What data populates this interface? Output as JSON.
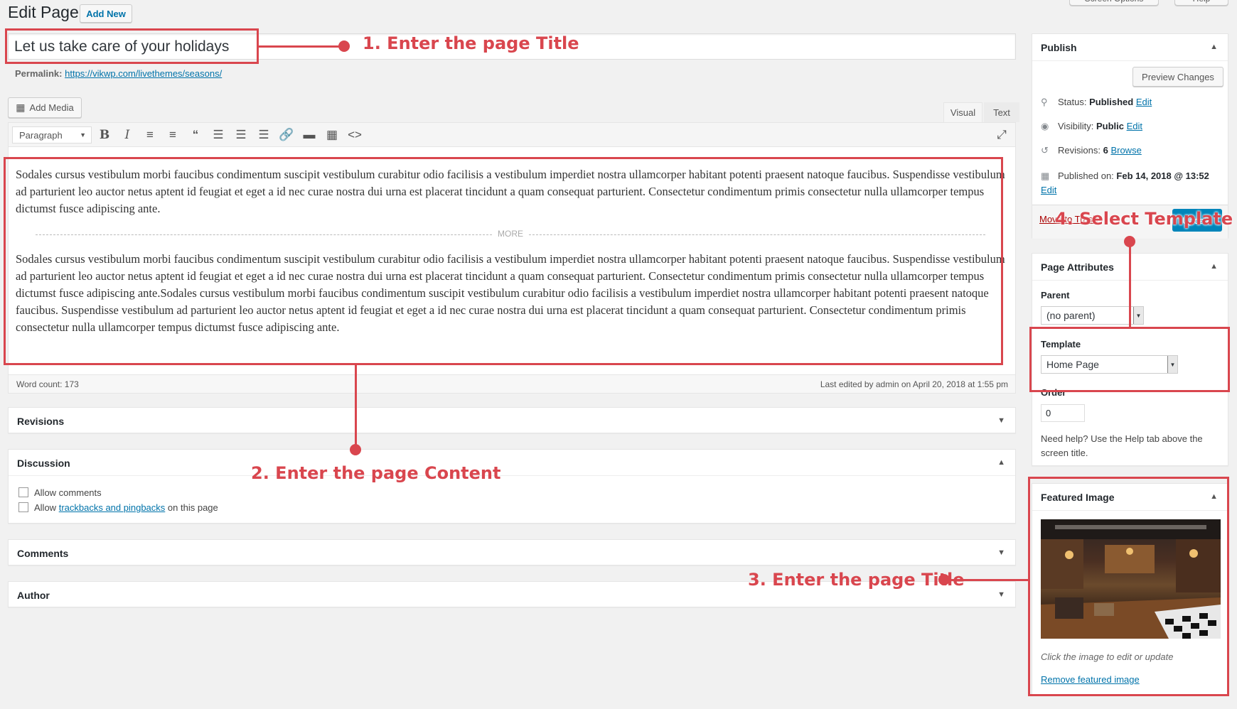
{
  "header": {
    "title": "Edit Page",
    "add_new": "Add New",
    "screen_options": "Screen Options",
    "help": "Help"
  },
  "editor": {
    "title_value": "Let us take care of your holidays",
    "permalink_label": "Permalink:",
    "permalink_url": "https://vikwp.com/livethemes/seasons/",
    "add_media": "Add Media",
    "tab_visual": "Visual",
    "tab_text": "Text",
    "format_select": "Paragraph",
    "paragraph1": "Sodales cursus vestibulum morbi faucibus condimentum suscipit vestibulum curabitur odio facilisis a vestibulum imperdiet nostra ullamcorper habitant potenti praesent natoque faucibus. Suspendisse vestibulum ad parturient leo auctor netus aptent id feugiat et eget a id nec curae nostra dui urna est placerat tincidunt a quam consequat parturient. Consectetur condimentum primis consectetur nulla ullamcorper tempus dictumst fusce adipiscing ante.",
    "more_label": "MORE",
    "paragraph2": "Sodales cursus vestibulum morbi faucibus condimentum suscipit vestibulum curabitur odio facilisis a vestibulum imperdiet nostra ullamcorper habitant potenti praesent natoque faucibus. Suspendisse vestibulum ad parturient leo auctor netus aptent id feugiat et eget a id nec curae nostra dui urna est placerat tincidunt a quam consequat parturient. Consectetur condimentum primis consectetur nulla ullamcorper tempus dictumst fusce adipiscing ante.Sodales cursus vestibulum morbi faucibus condimentum suscipit vestibulum curabitur odio facilisis a vestibulum imperdiet nostra ullamcorper habitant potenti praesent natoque faucibus. Suspendisse vestibulum ad parturient leo auctor netus aptent id feugiat et eget a id nec curae nostra dui urna est placerat tincidunt a quam consequat parturient. Consectetur condimentum primis consectetur nulla ullamcorper tempus dictumst fusce adipiscing ante.",
    "word_count": "Word count: 173",
    "last_edited": "Last edited by admin on April 20, 2018 at 1:55 pm"
  },
  "boxes": {
    "revisions": "Revisions",
    "discussion": "Discussion",
    "allow_comments": "Allow comments",
    "allow_prefix": "Allow",
    "trackbacks_link": "trackbacks and pingbacks",
    "allow_suffix": "on this page",
    "comments": "Comments",
    "author": "Author"
  },
  "publish": {
    "title": "Publish",
    "preview": "Preview Changes",
    "status_label": "Status:",
    "status_value": "Published",
    "visibility_label": "Visibility:",
    "visibility_value": "Public",
    "revisions_label": "Revisions:",
    "revisions_value": "6",
    "browse": "Browse",
    "published_label": "Published on:",
    "published_value": "Feb 14, 2018 @ 13:52",
    "edit": "Edit",
    "move_trash": "Move to Trash",
    "update": "Update"
  },
  "attributes": {
    "title": "Page Attributes",
    "parent_label": "Parent",
    "parent_value": "(no parent)",
    "template_label": "Template",
    "template_value": "Home Page",
    "order_label": "Order",
    "order_value": "0",
    "help_text": "Need help? Use the Help tab above the screen title."
  },
  "featured": {
    "title": "Featured Image",
    "caption": "Click the image to edit or update",
    "remove": "Remove featured image"
  },
  "annotations": {
    "a1": "1. Enter the page Title",
    "a2": "2. Enter the page Content",
    "a3": "3. Enter the page Title",
    "a4": "4. Select Template",
    "color": "#d9464e"
  }
}
